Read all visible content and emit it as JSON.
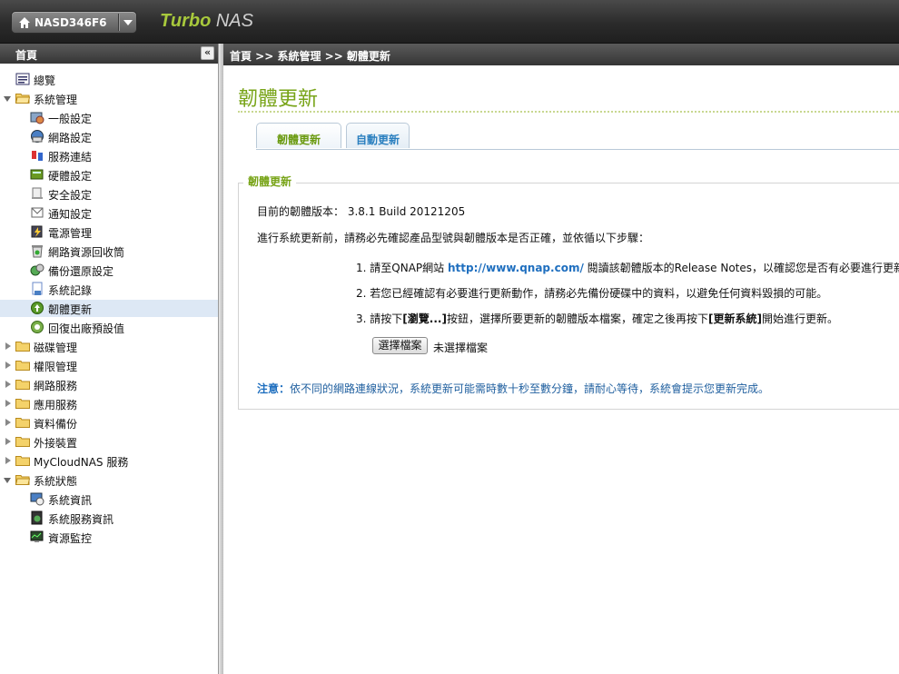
{
  "header": {
    "nas_name": "NASD346F6",
    "brand_turbo": "Turbo",
    "brand_nas": "NAS"
  },
  "sidebar": {
    "title": "首頁",
    "collapse_label": "«",
    "items": [
      {
        "label": "總覽"
      },
      {
        "label": "系統管理"
      },
      {
        "label": "一般設定"
      },
      {
        "label": "網路設定"
      },
      {
        "label": "服務連結"
      },
      {
        "label": "硬體設定"
      },
      {
        "label": "安全設定"
      },
      {
        "label": "通知設定"
      },
      {
        "label": "電源管理"
      },
      {
        "label": "網路資源回收筒"
      },
      {
        "label": "備份還原設定"
      },
      {
        "label": "系統記錄"
      },
      {
        "label": "韌體更新"
      },
      {
        "label": "回復出廠預設值"
      },
      {
        "label": "磁碟管理"
      },
      {
        "label": "權限管理"
      },
      {
        "label": "網路服務"
      },
      {
        "label": "應用服務"
      },
      {
        "label": "資料備份"
      },
      {
        "label": "外接裝置"
      },
      {
        "label": "MyCloudNAS 服務"
      },
      {
        "label": "系統狀態"
      },
      {
        "label": "系統資訊"
      },
      {
        "label": "系統服務資訊"
      },
      {
        "label": "資源監控"
      }
    ]
  },
  "main": {
    "breadcrumb": "首頁 >> 系統管理 >> 韌體更新",
    "page_title": "韌體更新",
    "tabs": [
      {
        "label": "韌體更新"
      },
      {
        "label": "自動更新"
      }
    ],
    "section_legend": "韌體更新",
    "current_version_label": "目前的韌體版本：",
    "current_version_value": "3.8.1 Build 20121205",
    "intro": "進行系統更新前，請務必先確認產品型號與韌體版本是否正確，並依循以下步驟：",
    "step1_num": "1.",
    "step1_pre": "請至QNAP網站",
    "step1_link": "http://www.qnap.com/",
    "step1_post": "閱讀該韌體版本的Release Notes，以確認您是否有必要進行更新。",
    "step2_num": "2.",
    "step2": "若您已經確認有必要進行更新動作，請務必先備份硬碟中的資料，以避免任何資料毀損的可能。",
    "step3_num": "3.",
    "step3_a": "請按下",
    "step3_b": "[瀏覽...]",
    "step3_c": "按鈕，選擇所要更新的韌體版本檔案，確定之後再按下",
    "step3_d": "[更新系統]",
    "step3_e": "開始進行更新。",
    "choose_file_button": "選擇檔案",
    "no_file_text": "未選擇檔案",
    "note_label": "注意：",
    "note_text": "依不同的網路連線狀況，系統更新可能需時數十秒至數分鐘，請耐心等待，系統會提示您更新完成。"
  },
  "colors": {
    "accent_green": "#78a418",
    "link_blue": "#1f6fbf",
    "selected_row": "#dde8f5"
  }
}
